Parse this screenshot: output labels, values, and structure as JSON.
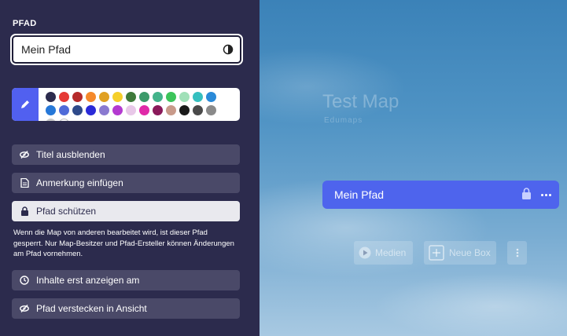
{
  "panel": {
    "section_label": "PFAD",
    "name_value": "Mein Pfad",
    "colors": [
      "#2c2b4d",
      "#e53935",
      "#b52a2a",
      "#f5892b",
      "#e0a022",
      "#f5cf2a",
      "#3f7a3a",
      "#3c9a6a",
      "#43b38a",
      "#3cc45a",
      "#a0e0b8",
      "#35bfbf",
      "#2a8ad8",
      "#2678d8",
      "#4f6bd8",
      "#2f4a8a",
      "#2a2ad8",
      "#8a7ad0",
      "#b43ad0",
      "#e8c8e8",
      "#e02aa8",
      "#8a1a5a",
      "#c89a8a",
      "#1a1a1a",
      "#4a4a4a",
      "#8a8a8a",
      "#c8c8c8",
      "#ffffff"
    ],
    "actions": {
      "hide_title": "Titel ausblenden",
      "add_note": "Anmerkung einfügen",
      "protect": "Pfad schützen",
      "show_content_from": "Inhalte erst anzeigen am",
      "hide_in_view": "Pfad verstecken in Ansicht"
    },
    "protect_note": "Wenn die Map von anderen bearbeitet wird, ist dieser Pfad gesperrt. Nur Map-Besitzer und Pfad-Ersteller können Änderungen am Pfad vornehmen."
  },
  "map": {
    "title": "Test Map",
    "subtitle": "Edumaps",
    "path_card_title": "Mein Pfad",
    "media_label": "Medien",
    "new_box_label": "Neue Box"
  },
  "icons": {
    "contrast": "contrast-icon",
    "pen": "pen-icon",
    "eye_slash": "eye-slash-icon",
    "document": "document-icon",
    "lock": "lock-icon",
    "clock": "clock-icon",
    "play": "play-icon",
    "plus": "plus-box-icon",
    "more": "more-vertical-icon"
  },
  "accent": "#4e64ed"
}
